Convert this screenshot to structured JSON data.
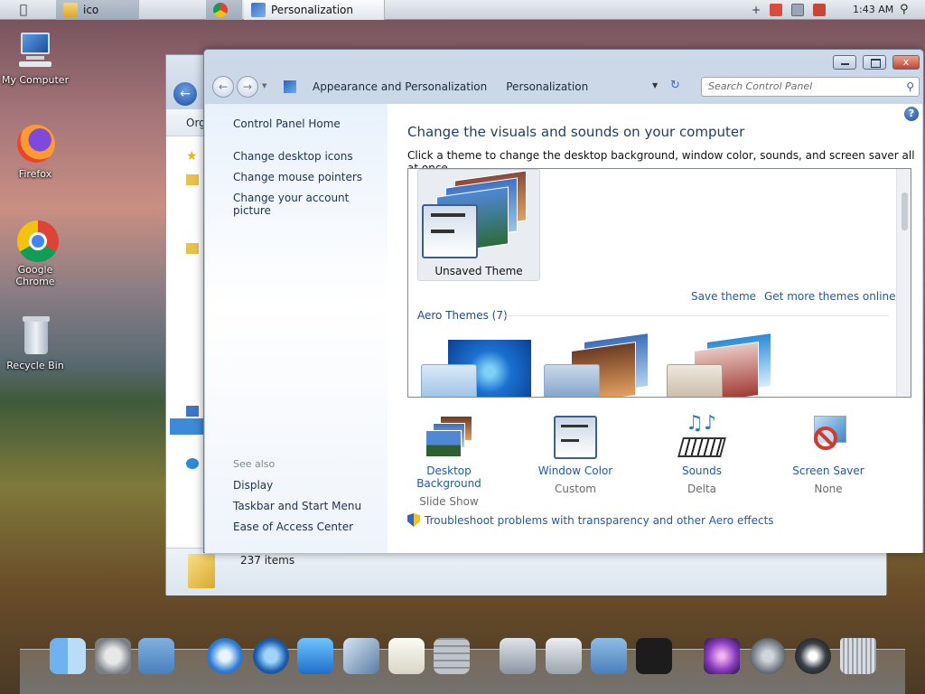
{
  "taskbar": {
    "apple_icon": "apple-icon",
    "buttons": [
      {
        "label": "ico",
        "icon": "folder-icon"
      },
      {
        "label": "",
        "icon": "chrome-icon"
      },
      {
        "label": "Personalization",
        "icon": "control-panel-icon"
      }
    ],
    "clock": "1:43 AM"
  },
  "desktop_icons": [
    {
      "label": "My Computer",
      "icon": "computer-icon"
    },
    {
      "label": "Firefox",
      "icon": "firefox-icon"
    },
    {
      "label": "Google Chrome",
      "icon": "chrome-icon"
    },
    {
      "label": "Recycle Bin",
      "icon": "recycle-bin-icon"
    }
  ],
  "explorer": {
    "organize_label": "Org",
    "status": "237 items"
  },
  "window": {
    "close_glyph": "x",
    "breadcrumb": [
      "Appearance and Personalization",
      "Personalization"
    ],
    "search_placeholder": "Search Control Panel",
    "help_glyph": "?",
    "side_links": [
      "Control Panel Home",
      "Change desktop icons",
      "Change mouse pointers",
      "Change your account picture"
    ],
    "see_also_label": "See also",
    "see_also_links": [
      "Display",
      "Taskbar and Start Menu",
      "Ease of Access Center"
    ],
    "heading": "Change the visuals and sounds on your computer",
    "subheading": "Click a theme to change the desktop background, window color, sounds, and screen saver all at once.",
    "unsaved_theme_label": "Unsaved Theme",
    "save_theme_link": "Save theme",
    "get_more_link": "Get more themes online",
    "aero_group_label": "Aero Themes (7)",
    "tools": [
      {
        "name": "Desktop Background",
        "value": "Slide Show",
        "icon": "desktop-background-icon"
      },
      {
        "name": "Window Color",
        "value": "Custom",
        "icon": "window-color-icon"
      },
      {
        "name": "Sounds",
        "value": "Delta",
        "icon": "sounds-icon"
      },
      {
        "name": "Screen Saver",
        "value": "None",
        "icon": "screen-saver-icon"
      }
    ],
    "troubleshoot_link": "Troubleshoot problems with transparency and other Aero effects"
  },
  "colors": {
    "link": "#1f5aa8",
    "heading": "#1e3f66",
    "close": "#c2452f"
  },
  "dock": {
    "icons": [
      "finder-icon",
      "system-preferences-icon",
      "users-folder-icon",
      "safari-icon",
      "quicktime-icon",
      "writer-icon",
      "preview-icon",
      "textedit-icon",
      "calculator-icon",
      "app-store-icon",
      "disk-utility-icon",
      "library-folder-icon",
      "dashboard-icon",
      "photo-booth-icon",
      "launchpad-icon",
      "power-icon",
      "trash-icon"
    ]
  }
}
